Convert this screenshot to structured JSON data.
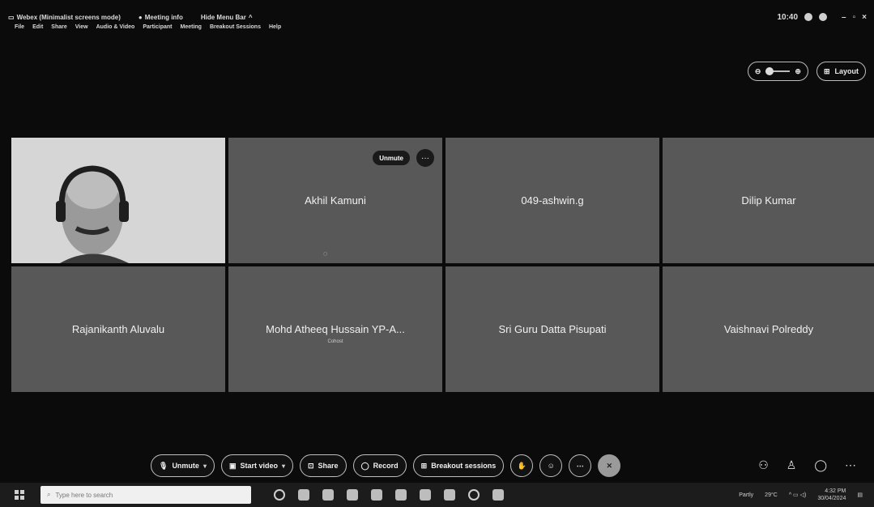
{
  "titlebar": {
    "app_title": "Webex (Minimalist screens mode)",
    "meeting_info": "Meeting info",
    "hide_menu_bar": "Hide Menu Bar",
    "time": "10:40"
  },
  "menu": [
    "File",
    "Edit",
    "Share",
    "View",
    "Audio & Video",
    "Participant",
    "Meeting",
    "Breakout Sessions",
    "Help"
  ],
  "layout_button": "Layout",
  "tile_controls": {
    "unmute": "Unmute",
    "more": "···"
  },
  "participants": [
    {
      "name": "",
      "video": true
    },
    {
      "name": "Akhil Kamuni",
      "video": false
    },
    {
      "name": "049-ashwin.g",
      "video": false
    },
    {
      "name": "Dilip Kumar",
      "video": false
    },
    {
      "name": "Rajanikanth Aluvalu",
      "video": false
    },
    {
      "name": "Mohd Atheeq Hussain YP-A...",
      "sub": "Cohost",
      "video": false
    },
    {
      "name": "Sri Guru Datta Pisupati",
      "video": false
    },
    {
      "name": "Vaishnavi Polreddy",
      "video": false
    }
  ],
  "toolbar": {
    "unmute": "Unmute",
    "start_video": "Start video",
    "share": "Share",
    "record": "Record",
    "breakout": "Breakout sessions"
  },
  "taskbar": {
    "search_placeholder": "Type here to search",
    "weather": "Partly",
    "temperature": "29°C",
    "clock_time": "4:32 PM",
    "clock_date": "30/04/2024"
  }
}
